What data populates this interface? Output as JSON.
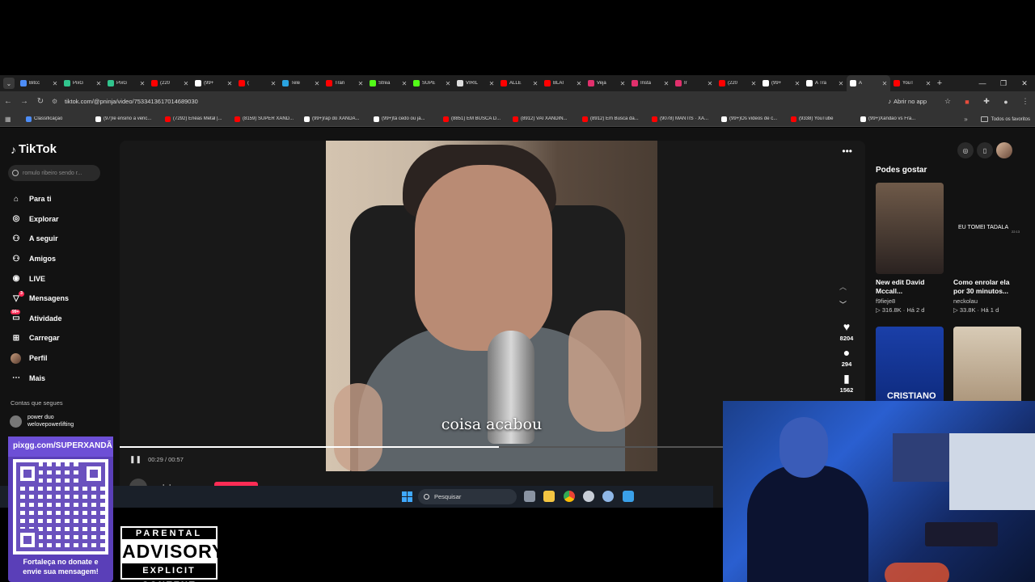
{
  "browser": {
    "tabs": [
      {
        "label": "Bitcc",
        "color": "#4d8df7"
      },
      {
        "label": "PixG",
        "color": "#31c48d"
      },
      {
        "label": "PixG",
        "color": "#31c48d"
      },
      {
        "label": "(220",
        "color": "#ff0000"
      },
      {
        "label": "(99+",
        "color": "#ffffff"
      },
      {
        "label": "(",
        "color": "#ff0000"
      },
      {
        "label": "Tele",
        "color": "#2aa3e0"
      },
      {
        "label": "Tran",
        "color": "#ff0000"
      },
      {
        "label": "Strea",
        "color": "#53fc18"
      },
      {
        "label": "SUPE",
        "color": "#53fc18"
      },
      {
        "label": "VIRIL",
        "color": "#dddddd"
      },
      {
        "label": "ALLE",
        "color": "#ff0000"
      },
      {
        "label": "BLAI",
        "color": "#ff0000"
      },
      {
        "label": "Veja",
        "color": "#e1306c"
      },
      {
        "label": "Insta",
        "color": "#e1306c"
      },
      {
        "label": "Ir",
        "color": "#e1306c"
      },
      {
        "label": "(220",
        "color": "#ff0000"
      },
      {
        "label": "(99+",
        "color": "#ffffff"
      },
      {
        "label": "A Tra",
        "color": "#ffffff"
      },
      {
        "label": "A",
        "color": "#ffffff"
      },
      {
        "label": "YouT",
        "color": "#ff0000"
      }
    ],
    "url": "tiktok.com/@pninja/video/7533413617014689030",
    "open_app": "Abrir no app",
    "bookmarks": [
      {
        "label": "Classificação",
        "color": "#4d8df7"
      },
      {
        "label": "(97)Ie ensino a venc...",
        "color": "#ffffff"
      },
      {
        "label": "(7292) Enéas Metal |...",
        "color": "#ff0000"
      },
      {
        "label": "(8159) SUPER XAND...",
        "color": "#ff0000"
      },
      {
        "label": "(99+)rap do XANDÃ...",
        "color": "#ffffff"
      },
      {
        "label": "(99+)tá cedo ou já...",
        "color": "#ffffff"
      },
      {
        "label": "(8851) EM BUSCA D...",
        "color": "#ff0000"
      },
      {
        "label": "(8912) VAI XANDIN...",
        "color": "#ff0000"
      },
      {
        "label": "(8912) Em Busca da...",
        "color": "#ff0000"
      },
      {
        "label": "(9078) MANTIS · XA...",
        "color": "#ff0000"
      },
      {
        "label": "(99+)Os vídeos de c...",
        "color": "#ffffff"
      },
      {
        "label": "(9338) YouTube",
        "color": "#ff0000"
      },
      {
        "label": "(99+)Xandão vs Fra...",
        "color": "#ffffff"
      }
    ],
    "all_bookmarks": "Todos os favoritos"
  },
  "tiktok": {
    "logo": "TikTok",
    "search_placeholder": "romulo ribeiro sendo r...",
    "menu": [
      {
        "label": "Para ti",
        "icon": "home-icon"
      },
      {
        "label": "Explorar",
        "icon": "compass-icon"
      },
      {
        "label": "A seguir",
        "icon": "following-icon"
      },
      {
        "label": "Amigos",
        "icon": "friends-icon"
      },
      {
        "label": "LIVE",
        "icon": "live-icon"
      },
      {
        "label": "Mensagens",
        "icon": "messages-icon",
        "badge": "3"
      },
      {
        "label": "Atividade",
        "icon": "activity-icon",
        "badge": "99+"
      },
      {
        "label": "Carregar",
        "icon": "upload-icon"
      },
      {
        "label": "Perfil",
        "icon": "profile-icon"
      },
      {
        "label": "Mais",
        "icon": "more-icon"
      }
    ],
    "following_title": "Contas que segues",
    "following": [
      {
        "name": "power duo",
        "handle": "welovepowerlifting"
      }
    ],
    "video": {
      "caption": "coisa acabou",
      "time": "00:29 / 00:57",
      "progress": 0.509,
      "author": "pninja",
      "likes": "8204",
      "comments": "294",
      "saves": "1562"
    },
    "suggestions_title": "Podes gostar",
    "suggestions": [
      {
        "title": "New edit David Mccall...",
        "author": "f9fieje8",
        "views": "316.8K",
        "age": "Há 2 d",
        "thumb_text": "",
        "thumb_dur": ""
      },
      {
        "title": "Como enrolar ela por 30 minutos...",
        "author": "neckolau",
        "views": "33.8K",
        "age": "Há 1 d",
        "thumb_text": "EU TOMEI TADALA",
        "thumb_dur": "22:13"
      },
      {
        "title": "",
        "author": "",
        "views": "",
        "age": "",
        "thumb_text": "CRISTIANO",
        "thumb_dur": ""
      },
      {
        "title": "",
        "author": "",
        "views": "",
        "age": "",
        "thumb_text": "",
        "thumb_dur": ""
      }
    ]
  },
  "taskbar": {
    "search_placeholder": "Pesquisar"
  },
  "overlay": {
    "pix_url": "pixgg.com/SUPERXANDÃ",
    "pix_message_1": "Fortaleça no donate e",
    "pix_message_2": "envie sua mensagem!",
    "advisory_top": "PARENTAL",
    "advisory_mid": "ADVISORY",
    "advisory_bot": "EXPLICIT CONTENT"
  }
}
